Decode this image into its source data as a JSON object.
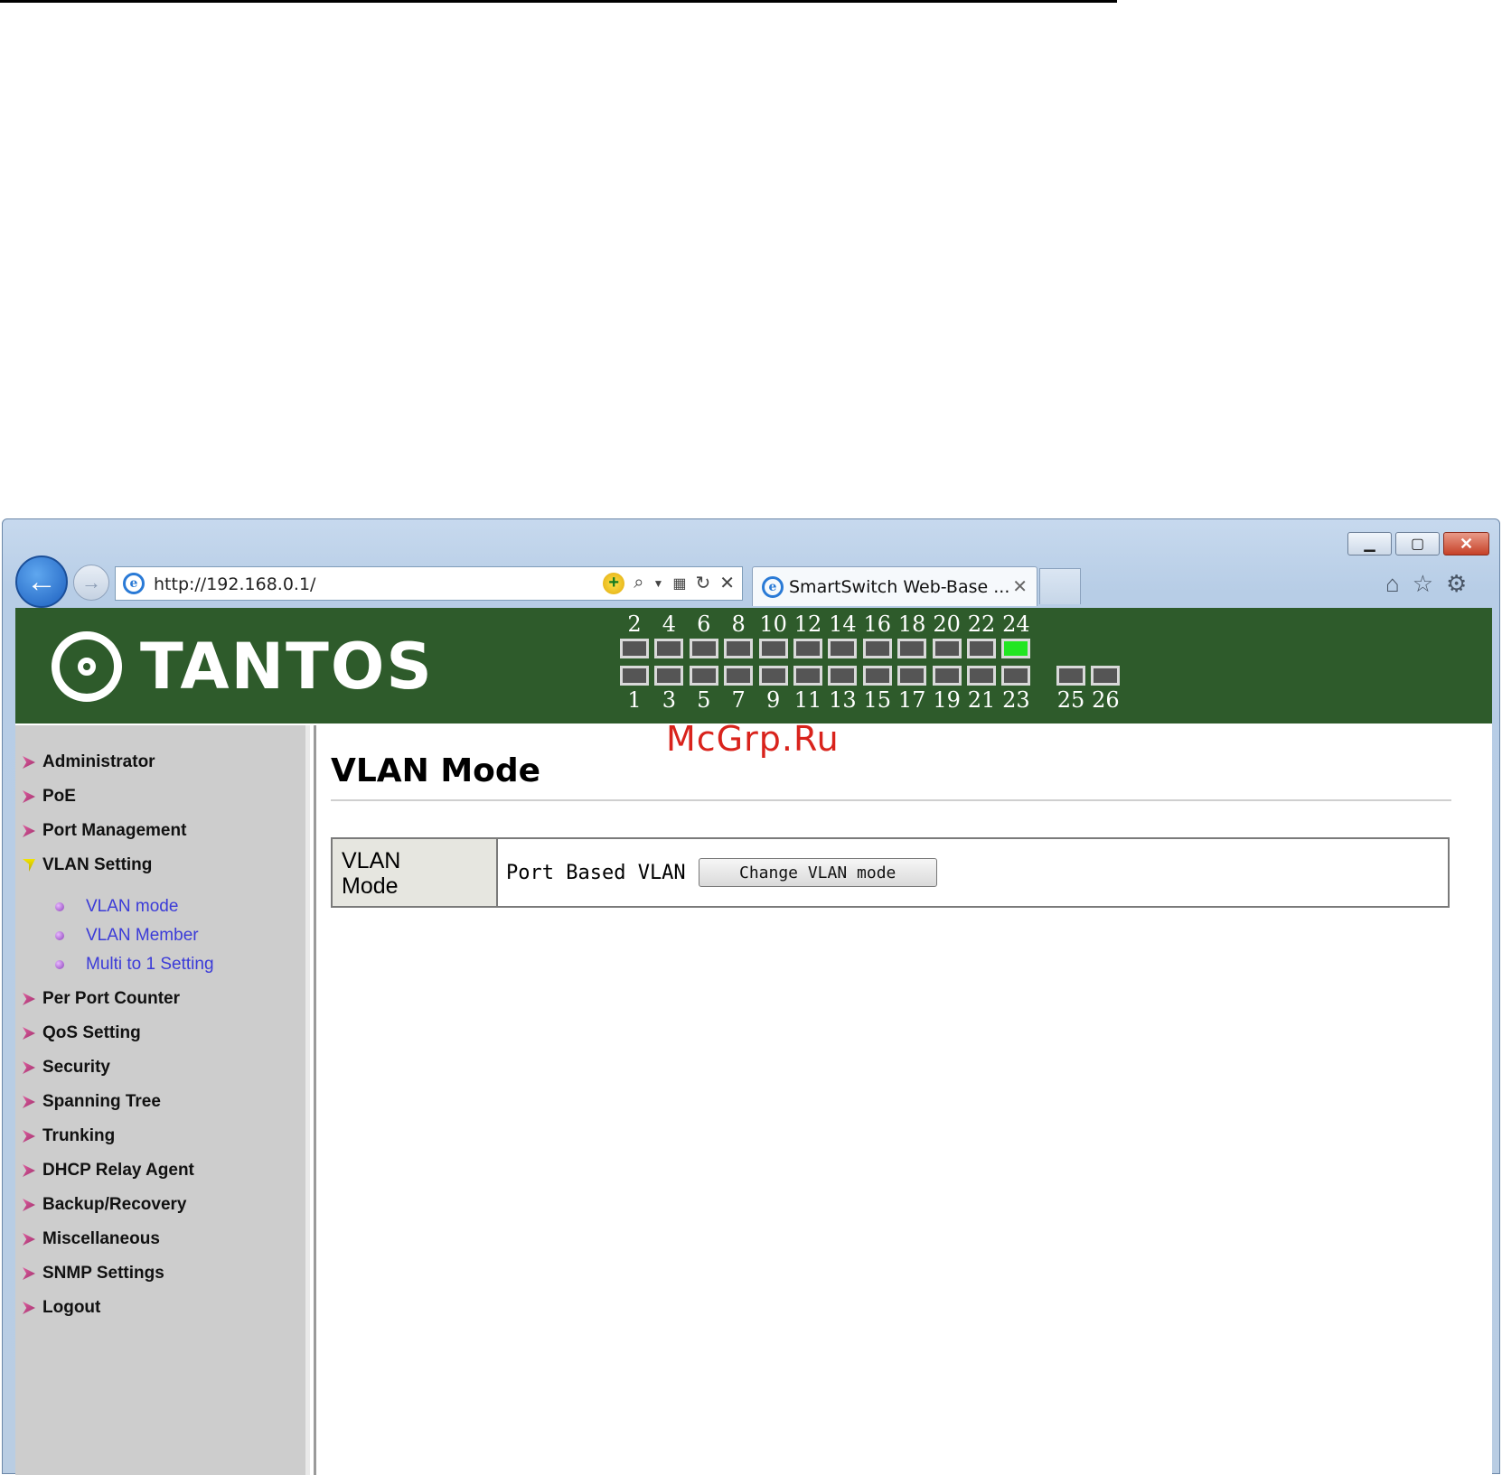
{
  "watermark": "McGrp.Ru",
  "browser": {
    "url": "http://192.168.0.1/",
    "tab_title": "SmartSwitch Web-Base ...",
    "back_icon": "arrow-left-icon",
    "forward_icon": "arrow-right-icon"
  },
  "banner": {
    "logo": "TANTOS",
    "ports_top": [
      {
        "n": "2",
        "active": false
      },
      {
        "n": "4",
        "active": false
      },
      {
        "n": "6",
        "active": false
      },
      {
        "n": "8",
        "active": false
      },
      {
        "n": "10",
        "active": false
      },
      {
        "n": "12",
        "active": false
      },
      {
        "n": "14",
        "active": false
      },
      {
        "n": "16",
        "active": false
      },
      {
        "n": "18",
        "active": false
      },
      {
        "n": "20",
        "active": false
      },
      {
        "n": "22",
        "active": false
      },
      {
        "n": "24",
        "active": true
      }
    ],
    "ports_bottom": [
      {
        "n": "1",
        "active": false
      },
      {
        "n": "3",
        "active": false
      },
      {
        "n": "5",
        "active": false
      },
      {
        "n": "7",
        "active": false
      },
      {
        "n": "9",
        "active": false
      },
      {
        "n": "11",
        "active": false
      },
      {
        "n": "13",
        "active": false
      },
      {
        "n": "15",
        "active": false
      },
      {
        "n": "17",
        "active": false
      },
      {
        "n": "19",
        "active": false
      },
      {
        "n": "21",
        "active": false
      },
      {
        "n": "23",
        "active": false
      }
    ],
    "ports_uplink": [
      {
        "n": "25",
        "active": false
      },
      {
        "n": "26",
        "active": false
      }
    ]
  },
  "sidebar": {
    "items": [
      {
        "label": "Administrator",
        "open": false
      },
      {
        "label": "PoE",
        "open": false
      },
      {
        "label": "Port Management",
        "open": false
      },
      {
        "label": "VLAN Setting",
        "open": true
      },
      {
        "label": "Per Port Counter",
        "open": false
      },
      {
        "label": "QoS Setting",
        "open": false
      },
      {
        "label": "Security",
        "open": false
      },
      {
        "label": "Spanning Tree",
        "open": false
      },
      {
        "label": "Trunking",
        "open": false
      },
      {
        "label": "DHCP Relay Agent",
        "open": false
      },
      {
        "label": "Backup/Recovery",
        "open": false
      },
      {
        "label": "Miscellaneous",
        "open": false
      },
      {
        "label": "SNMP Settings",
        "open": false
      },
      {
        "label": "Logout",
        "open": false
      }
    ],
    "subitems": [
      {
        "label": "VLAN mode"
      },
      {
        "label": "VLAN Member"
      },
      {
        "label": "Multi to 1 Setting"
      }
    ]
  },
  "main": {
    "title": "VLAN Mode",
    "row_label_line1": "VLAN",
    "row_label_line2": "Mode",
    "row_value": "Port Based VLAN",
    "button_label": "Change VLAN mode"
  }
}
